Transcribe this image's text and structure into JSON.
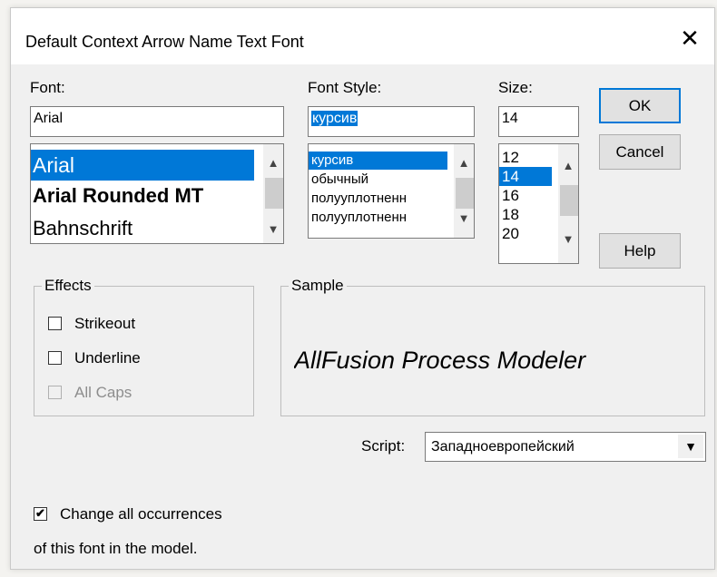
{
  "dialog": {
    "title": "Default Context Arrow Name Text Font",
    "close_glyph": "✕"
  },
  "font": {
    "label": "Font:",
    "value": "Arial",
    "items": [
      {
        "text": "Arial",
        "selected": true
      },
      {
        "text": "Arial Rounded MT",
        "selected": false
      },
      {
        "text": "Bahnschrift",
        "selected": false
      }
    ]
  },
  "style": {
    "label": "Font Style:",
    "value": "курсив",
    "items": [
      {
        "text": "курсив",
        "selected": true
      },
      {
        "text": "обычный",
        "selected": false
      },
      {
        "text": "полууплотненн",
        "selected": false
      },
      {
        "text": "полууплотненн",
        "selected": false
      }
    ]
  },
  "size": {
    "label": "Size:",
    "value": "14",
    "items": [
      {
        "text": "12",
        "selected": false
      },
      {
        "text": "14",
        "selected": true
      },
      {
        "text": "16",
        "selected": false
      },
      {
        "text": "18",
        "selected": false
      },
      {
        "text": "20",
        "selected": false
      }
    ]
  },
  "buttons": {
    "ok": "OK",
    "cancel": "Cancel",
    "help": "Help"
  },
  "effects": {
    "title": "Effects",
    "strikeout": {
      "label": "Strikeout",
      "checked": false,
      "enabled": true
    },
    "underline": {
      "label": "Underline",
      "checked": false,
      "enabled": true
    },
    "all_caps": {
      "label": "All Caps",
      "checked": false,
      "enabled": false
    }
  },
  "sample": {
    "title": "Sample",
    "text": "AllFusion Process Modeler"
  },
  "script": {
    "label": "Script:",
    "value": "Западноевропейский"
  },
  "change_all": {
    "checked": true,
    "line1": "Change all occurrences",
    "line2": "of this font in the model."
  },
  "icons": {
    "scroll_up": "up-arrow",
    "scroll_down": "down-arrow",
    "dropdown": "dropdown-arrow",
    "checkmark": "check"
  }
}
